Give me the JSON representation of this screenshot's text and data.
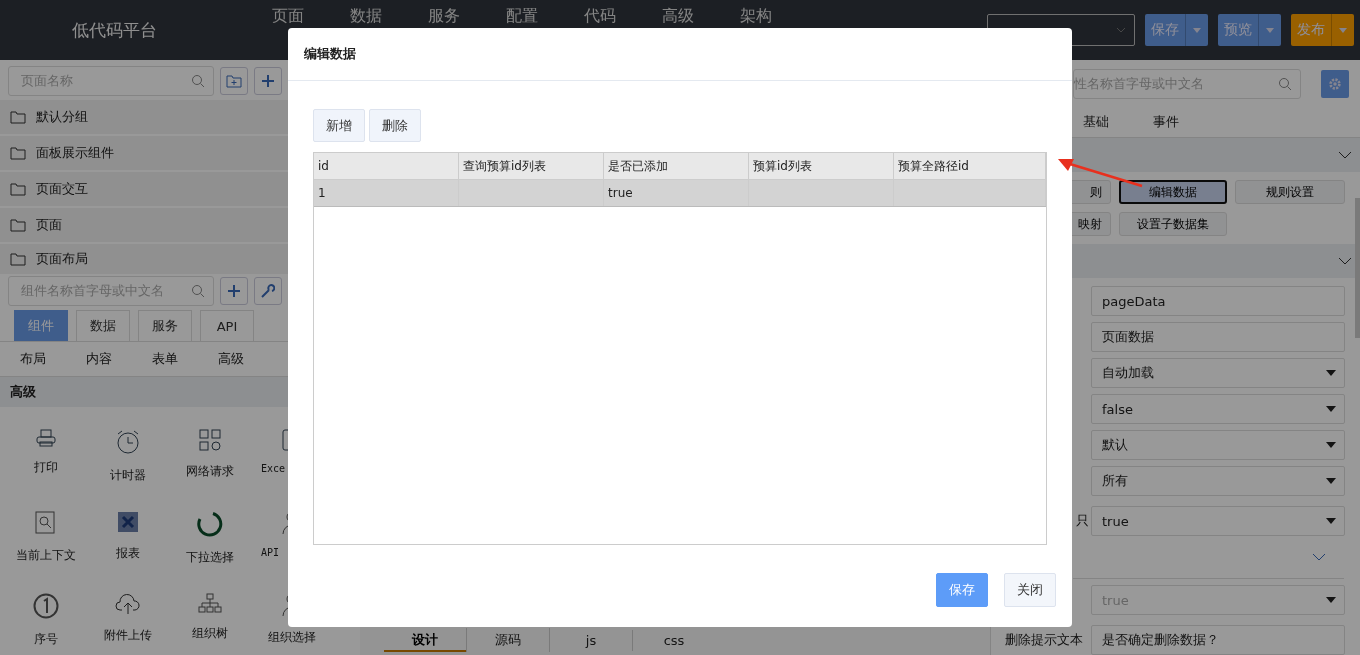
{
  "header": {
    "title": "低代码平台",
    "nav": [
      {
        "label": "页面"
      },
      {
        "label": "数据"
      },
      {
        "label": "服务"
      },
      {
        "label": "配置"
      },
      {
        "label": "代码"
      },
      {
        "label": "高级"
      },
      {
        "label": "架构"
      }
    ],
    "actions": [
      {
        "label": "保存",
        "kind": "primary"
      },
      {
        "label": "预览",
        "kind": "primary"
      },
      {
        "label": "发布",
        "kind": "warning"
      }
    ]
  },
  "page_panel": {
    "search": {
      "placeholder": "页面名称"
    },
    "groups": [
      "默认分组",
      "面板展示组件",
      "页面交互",
      "页面",
      "页面布局"
    ]
  },
  "component_panel": {
    "search": {
      "placeholder": "组件名称首字母或中文名"
    },
    "tabs": [
      {
        "label": "组件",
        "selected": true
      },
      {
        "label": "数据",
        "selected": false
      },
      {
        "label": "服务",
        "selected": false
      },
      {
        "label": "API",
        "selected": false
      }
    ],
    "categories": [
      "布局",
      "内容",
      "表单",
      "高级"
    ],
    "section": "高级",
    "items": [
      {
        "label": "打印",
        "kind": "printer"
      },
      {
        "label": "计时器",
        "kind": "clock"
      },
      {
        "label": "网络请求",
        "kind": "grid"
      },
      {
        "label": "Exce",
        "kind": "sheet"
      },
      {
        "label": "当前上下文",
        "kind": "document"
      },
      {
        "label": "报表",
        "kind": "report"
      },
      {
        "label": "下拉选择",
        "kind": "spinner"
      },
      {
        "label": "API",
        "kind": "people"
      },
      {
        "label": "序号",
        "kind": "number"
      },
      {
        "label": "附件上传",
        "kind": "upload"
      },
      {
        "label": "组织树",
        "kind": "tree"
      },
      {
        "label": "组织选择",
        "kind": "people"
      }
    ]
  },
  "editor_tabs": [
    {
      "label": "设计",
      "selected": true
    },
    {
      "label": "源码",
      "selected": false
    },
    {
      "label": "js",
      "selected": false
    },
    {
      "label": "css",
      "selected": false
    }
  ],
  "property_panel": {
    "search": {
      "placeholder": "性名称首字母或中文名"
    },
    "tabs": [
      "基础",
      "事件"
    ],
    "buttons": [
      {
        "label": "则",
        "selected": false
      },
      {
        "label": "编辑数据",
        "selected": true
      },
      {
        "label": "规则设置",
        "selected": false
      },
      {
        "label": "映射",
        "selected": false
      },
      {
        "label": "设置子数据集",
        "selected": false
      }
    ],
    "fields": [
      {
        "value": "pageData",
        "kind": "text",
        "disabled": false
      },
      {
        "value": "页面数据",
        "kind": "text",
        "disabled": false
      },
      {
        "value": "自动加载",
        "kind": "select",
        "disabled": false
      },
      {
        "value": "false",
        "kind": "select",
        "disabled": false
      },
      {
        "value": "默认",
        "kind": "select",
        "disabled": false
      },
      {
        "value": "所有",
        "kind": "select",
        "disabled": false
      },
      {
        "label": "只",
        "value": "true",
        "kind": "select",
        "disabled": false
      }
    ],
    "subsection": {
      "fields": [
        {
          "value": "true",
          "kind": "select",
          "disabled": true
        },
        {
          "label": "删除提示文本",
          "value": "是否确定删除数据？",
          "kind": "text",
          "disabled": false
        }
      ]
    }
  },
  "dialog": {
    "title": "编辑数据",
    "toolbar": [
      "新增",
      "删除"
    ],
    "table": {
      "columns": [
        "id",
        "查询预算id列表",
        "是否已添加",
        "预算id列表",
        "预算全路径id"
      ],
      "rows": [
        {
          "cells": [
            "1",
            "",
            "true",
            "",
            ""
          ],
          "selected": true
        }
      ]
    },
    "buttons": [
      {
        "label": "保存",
        "kind": "primary"
      },
      {
        "label": "关闭",
        "kind": "default"
      }
    ]
  }
}
